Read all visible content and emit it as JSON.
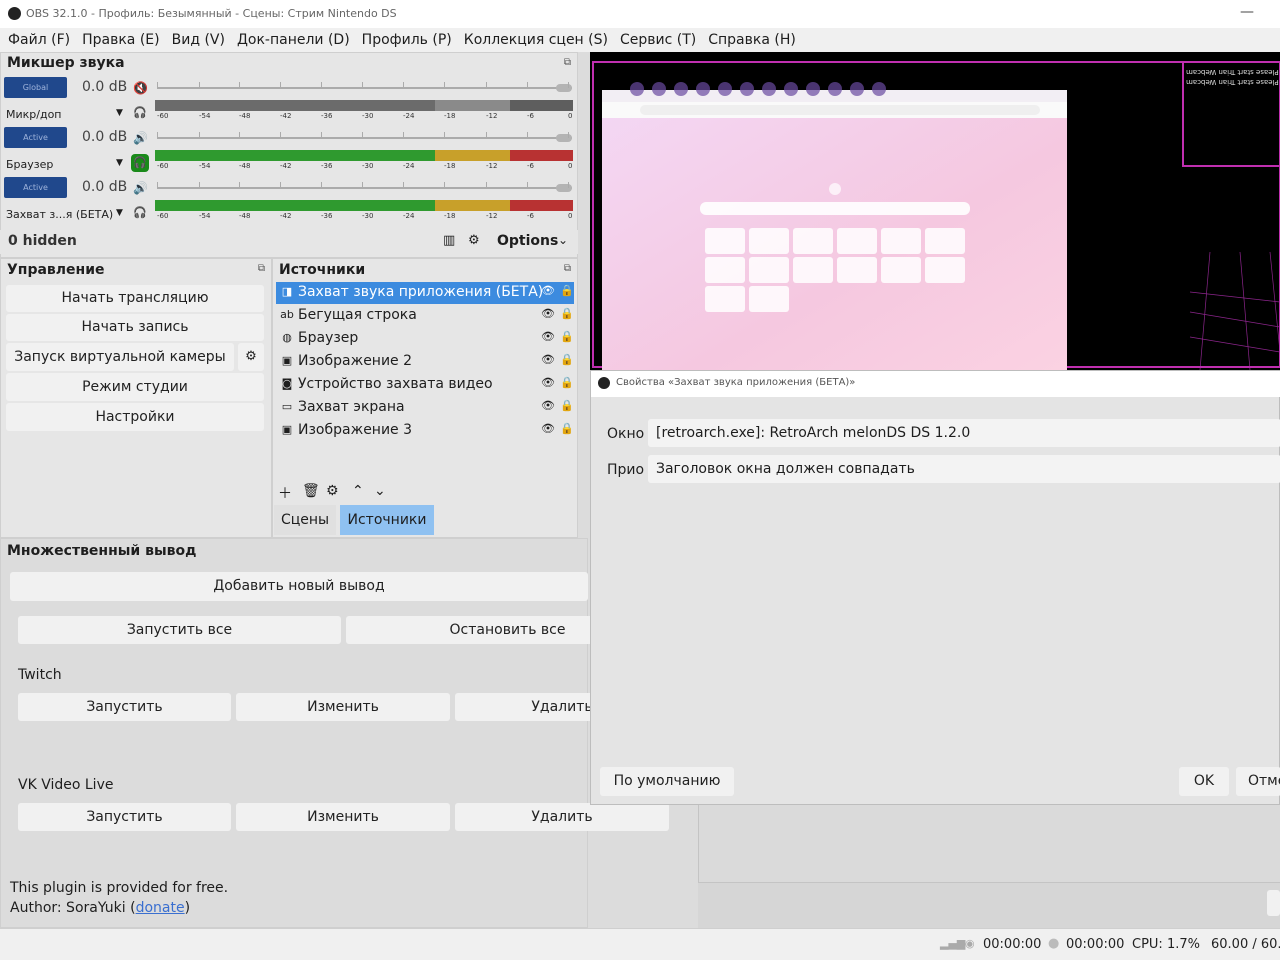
{
  "window": {
    "title": "OBS 32.1.0 - Профиль: Безымянный - Сцены: Стрим Nintendo DS"
  },
  "menu": [
    "Файл (F)",
    "Правка (E)",
    "Вид (V)",
    "Док-панели (D)",
    "Профиль (P)",
    "Коллекция сцен (S)",
    "Сервис (T)",
    "Справка (H)"
  ],
  "mixer": {
    "title": "Микшер звука",
    "ticks": [
      "-60",
      "-54",
      "-48",
      "-42",
      "-36",
      "-30",
      "-24",
      "-18",
      "-12",
      "-6",
      "0"
    ],
    "channels": [
      {
        "badge": "Global",
        "db": "0.0 dB",
        "name": "Микр/доп",
        "muted": true,
        "monitor": false
      },
      {
        "badge": "Active",
        "db": "0.0 dB",
        "name": "Браузер",
        "muted": false,
        "monitor": true
      },
      {
        "badge": "Active",
        "db": "0.0 dB",
        "name": "Захват з...я (БЕТА)",
        "muted": false,
        "monitor": false
      }
    ],
    "hidden_label": "0 hidden",
    "options_label": "Options"
  },
  "controls": {
    "title": "Управление",
    "buttons": [
      "Начать трансляцию",
      "Начать запись",
      "Запуск виртуальной камеры",
      "Режим студии",
      "Настройки"
    ]
  },
  "sources": {
    "title": "Источники",
    "items": [
      {
        "label": "Захват звука приложения (БЕТА)",
        "icon": "audio-capture-icon",
        "selected": true
      },
      {
        "label": "Бегущая строка",
        "icon": "text-icon",
        "selected": false
      },
      {
        "label": "Браузер",
        "icon": "globe-icon",
        "selected": false
      },
      {
        "label": "Изображение 2",
        "icon": "image-icon",
        "selected": false
      },
      {
        "label": "Устройство захвата видео",
        "icon": "camera-icon",
        "selected": false
      },
      {
        "label": "Захват экрана",
        "icon": "monitor-icon",
        "selected": false
      },
      {
        "label": "Изображение 3",
        "icon": "image-icon",
        "selected": false
      }
    ],
    "tabs": [
      "Сцены",
      "Источники"
    ]
  },
  "multi_output": {
    "title": "Множественный вывод",
    "add_label": "Добавить новый вывод",
    "start_all": "Запустить все",
    "stop_all": "Остановить все",
    "targets": [
      {
        "name": "Twitch",
        "start": "Запустить",
        "edit": "Изменить",
        "delete": "Удалить"
      },
      {
        "name": "VK Video Live",
        "start": "Запустить",
        "edit": "Изменить",
        "delete": "Удалить"
      }
    ],
    "free_text": "This plugin is provided for free.",
    "author_prefix": "Author: SoraYuki (",
    "donate": "donate",
    "author_suffix": ")"
  },
  "preview": {
    "overlay_text_1": "Please start Trian Webcam",
    "overlay_text_2": "Please start Trian Webcam"
  },
  "dialog": {
    "title": "Свойства «Захват звука приложения (БЕТА)»",
    "window_label": "Окно",
    "window_value": "[retroarch.exe]: RetroArch melonDS DS 1.2.0",
    "priority_label": "Прио",
    "priority_value": "Заголовок окна должен совпадать",
    "defaults": "По умолчанию",
    "ok": "OK",
    "cancel": "Отме"
  },
  "statusbar": {
    "stream_time": "00:00:00",
    "rec_time": "00:00:00",
    "cpu": "CPU: 1.7%",
    "fps": "60.00 / 60."
  },
  "colors": {
    "accent": "#3c8bdf",
    "badge": "#20488c",
    "meter_green": "#2f9a2f",
    "meter_yellow": "#c8a02a",
    "meter_red": "#b83232"
  }
}
